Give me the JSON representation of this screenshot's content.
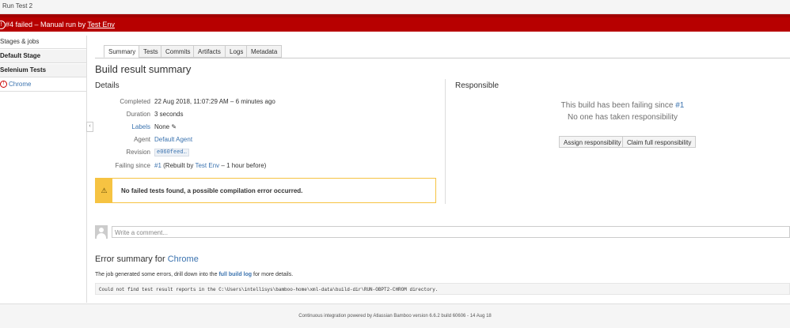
{
  "window": {
    "title": "Run Test 2"
  },
  "banner": {
    "prefix": "#4 failed – Manual run by",
    "user": "Test Env"
  },
  "sidebar": {
    "header": "Stages & jobs",
    "items": [
      {
        "label": "Default Stage"
      },
      {
        "label": "Selenium Tests"
      },
      {
        "label": "Chrome"
      }
    ]
  },
  "tabs": [
    "Summary",
    "Tests",
    "Commits",
    "Artifacts",
    "Logs",
    "Metadata"
  ],
  "main": {
    "title": "Build result summary",
    "details_heading": "Details",
    "details": {
      "completed_label": "Completed",
      "completed_value": "22 Aug 2018, 11:07:29 AM – 6 minutes ago",
      "duration_label": "Duration",
      "duration_value": "3 seconds",
      "labels_label": "Labels",
      "labels_value": "None",
      "agent_label": "Agent",
      "agent_value": "Default Agent",
      "revision_label": "Revision",
      "revision_value": "e060feed…",
      "failing_label": "Failing since",
      "failing_build": "#1",
      "failing_rebuilt": "(Rebuilt by",
      "failing_user": "Test Env",
      "failing_when": "– 1 hour before)"
    },
    "warning": "No failed tests found, a possible compilation error occurred."
  },
  "responsible": {
    "heading": "Responsible",
    "failing_text": "This build has been failing since",
    "failing_build": "#1",
    "no_one": "No one has taken responsibility",
    "assign_button": "Assign responsibility",
    "claim_button": "Claim full responsibility"
  },
  "comment": {
    "placeholder": "Write a comment..."
  },
  "error_summary": {
    "prefix": "Error summary for",
    "job": "Chrome",
    "text_before": "The job generated some errors, drill down into the",
    "link": "full build log",
    "text_after": "for more details.",
    "log_line": "Could not find test result reports in the C:\\Users\\intellisys\\bamboo-home\\xml-data\\build-dir\\RUN-OBPT2-CHROM directory."
  },
  "footer": {
    "text": "Continuous integration powered by Atlassian Bamboo version 6.6.2 build 60606 - 14 Aug 18"
  }
}
